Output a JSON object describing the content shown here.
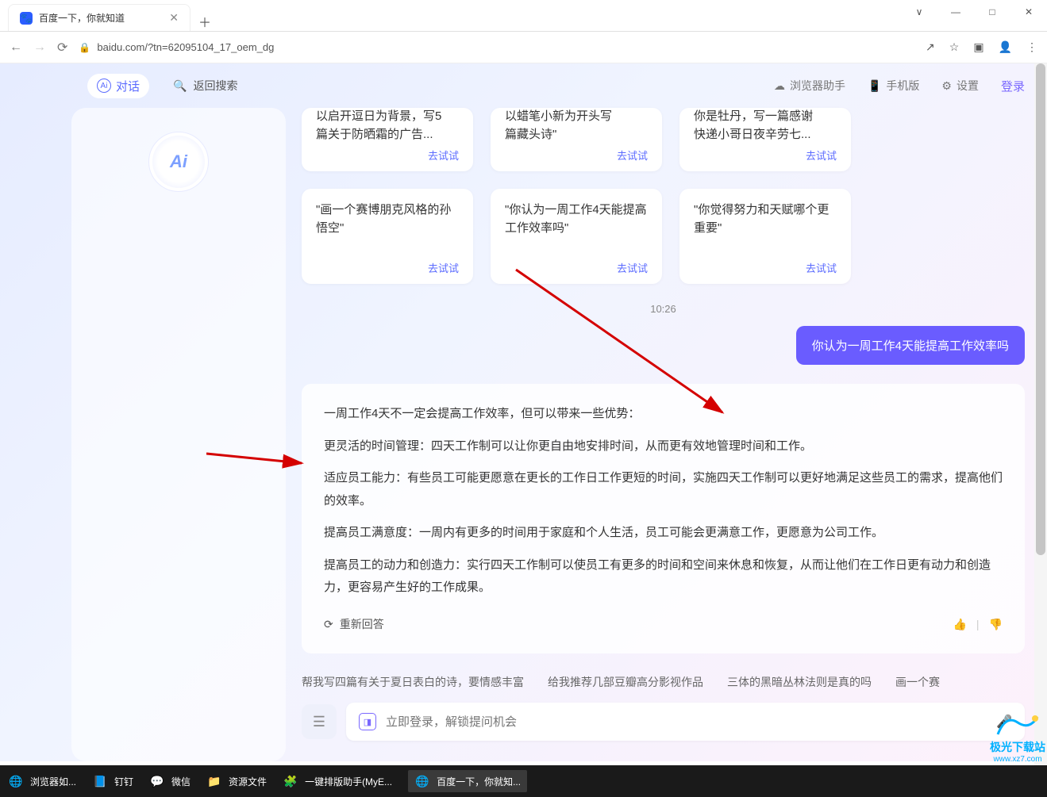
{
  "window": {
    "minimize": "—",
    "maximize": "□",
    "close": "✕",
    "restore_down": "🗗"
  },
  "tab": {
    "title": "百度一下，你就知道",
    "favicon_alt": "baidu-paw"
  },
  "addressbar": {
    "url": "baidu.com/?tn=62095104_17_oem_dg"
  },
  "page_header": {
    "chat_label": "对话",
    "back_search": "返回搜索",
    "right_items": {
      "browser_helper": "浏览器助手",
      "mobile": "手机版",
      "settings": "设置",
      "login": "登录"
    }
  },
  "ai_logo_text": "Ai",
  "cards_top": [
    {
      "line1": "以启开逗日为背景，写5",
      "line2": "篇关于防晒霜的广告...",
      "btn": "去试试"
    },
    {
      "line1": "以蜡笔小新为开头写",
      "line2": "篇藏头诗\"",
      "btn": "去试试"
    },
    {
      "line1": "你是牡丹，写一篇感谢",
      "line2": "快递小哥日夜辛劳七...",
      "btn": "去试试"
    }
  ],
  "cards_mid": [
    {
      "text": "\"画一个赛博朋克风格的孙悟空\"",
      "btn": "去试试"
    },
    {
      "text": "\"你认为一周工作4天能提高工作效率吗\"",
      "btn": "去试试"
    },
    {
      "text": "\"你觉得努力和天赋哪个更重要\"",
      "btn": "去试试"
    }
  ],
  "time_label": "10:26",
  "user_message": "你认为一周工作4天能提高工作效率吗",
  "answer": {
    "p1": "一周工作4天不一定会提高工作效率，但可以带来一些优势：",
    "p2": "更灵活的时间管理：四天工作制可以让你更自由地安排时间，从而更有效地管理时间和工作。",
    "p3": "适应员工能力：有些员工可能更愿意在更长的工作日工作更短的时间，实施四天工作制可以更好地满足这些员工的需求，提高他们的效率。",
    "p4": "提高员工满意度：一周内有更多的时间用于家庭和个人生活，员工可能会更满意工作，更愿意为公司工作。",
    "p5": "提高员工的动力和创造力：实行四天工作制可以使员工有更多的时间和空间来休息和恢复，从而让他们在工作日更有动力和创造力，更容易产生好的工作成果。"
  },
  "regen_label": "重新回答",
  "suggestions": [
    "帮我写四篇有关于夏日表白的诗，要情感丰富",
    "给我推荐几部豆瓣高分影视作品",
    "三体的黑暗丛林法则是真的吗",
    "画一个赛"
  ],
  "input_placeholder": "立即登录，解锁提问机会",
  "taskbar": {
    "items": [
      {
        "icon": "🌐",
        "label": "浏览器如..."
      },
      {
        "icon": "📘",
        "label": "钉钉"
      },
      {
        "icon": "💬",
        "label": "微信"
      },
      {
        "icon": "📁",
        "label": "资源文件"
      },
      {
        "icon": "🧩",
        "label": "一键排版助手(MyE..."
      },
      {
        "icon": "🌐",
        "label": "百度一下，你就知..."
      }
    ]
  },
  "watermark": {
    "text": "极光下载站",
    "url": "www.xz7.com"
  }
}
